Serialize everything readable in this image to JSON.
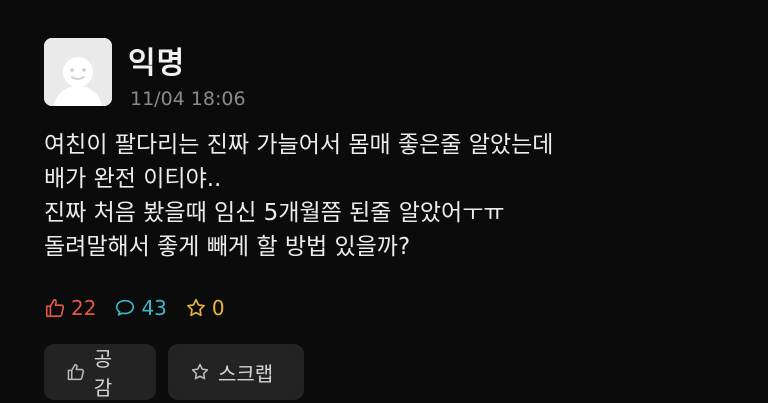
{
  "post": {
    "author": "익명",
    "timestamp": "11/04 18:06",
    "body_lines": [
      "여친이 팔다리는 진짜 가늘어서 몸매 좋은줄 알았는데",
      "배가 완전 이티야..",
      "진짜 처음 봤을때 임신 5개월쯤 된줄 알았어ㅜㅠ",
      "돌려말해서 좋게 빼게 할 방법 있을까?"
    ],
    "stats": {
      "likes": "22",
      "comments": "43",
      "scraps": "0"
    },
    "actions": {
      "empathy_label": "공감",
      "scrap_label": "스크랩"
    }
  },
  "colors": {
    "background": "#0b0b0b",
    "like": "#e2574c",
    "comment": "#3bb8c9",
    "scrap": "#e7b73a",
    "button_bg": "#232323"
  },
  "icons": {
    "avatar": "default-user-avatar",
    "like": "thumbs-up-icon",
    "comment": "speech-bubble-icon",
    "scrap": "star-icon"
  }
}
